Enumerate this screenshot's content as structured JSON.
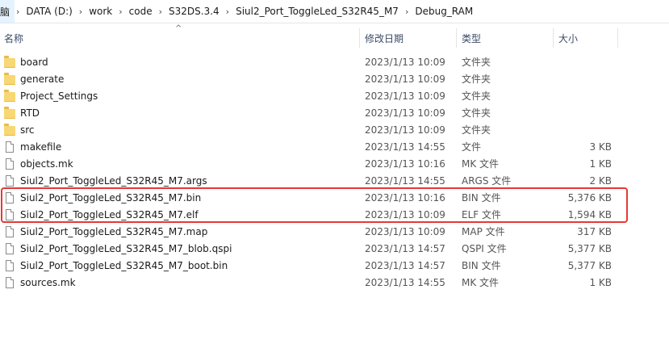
{
  "breadcrumb": {
    "items": [
      "脑",
      "DATA (D:)",
      "work",
      "code",
      "S32DS.3.4",
      "Siul2_Port_ToggleLed_S32R45_M7",
      "Debug_RAM"
    ],
    "separator": "›"
  },
  "columns": {
    "name": "名称",
    "date": "修改日期",
    "type": "类型",
    "size": "大小",
    "sort_indicator": "^"
  },
  "files": [
    {
      "name": "board",
      "date": "2023/1/13 10:09",
      "type": "文件夹",
      "size": "",
      "icon": "folder-icon"
    },
    {
      "name": "generate",
      "date": "2023/1/13 10:09",
      "type": "文件夹",
      "size": "",
      "icon": "folder-icon"
    },
    {
      "name": "Project_Settings",
      "date": "2023/1/13 10:09",
      "type": "文件夹",
      "size": "",
      "icon": "folder-icon"
    },
    {
      "name": "RTD",
      "date": "2023/1/13 10:09",
      "type": "文件夹",
      "size": "",
      "icon": "folder-icon"
    },
    {
      "name": "src",
      "date": "2023/1/13 10:09",
      "type": "文件夹",
      "size": "",
      "icon": "folder-icon"
    },
    {
      "name": "makefile",
      "date": "2023/1/13 14:55",
      "type": "文件",
      "size": "3 KB",
      "icon": "file-icon"
    },
    {
      "name": "objects.mk",
      "date": "2023/1/13 10:16",
      "type": "MK 文件",
      "size": "1 KB",
      "icon": "file-icon"
    },
    {
      "name": "Siul2_Port_ToggleLed_S32R45_M7.args",
      "date": "2023/1/13 14:55",
      "type": "ARGS 文件",
      "size": "2 KB",
      "icon": "file-icon"
    },
    {
      "name": "Siul2_Port_ToggleLed_S32R45_M7.bin",
      "date": "2023/1/13 10:16",
      "type": "BIN 文件",
      "size": "5,376 KB",
      "icon": "file-icon"
    },
    {
      "name": "Siul2_Port_ToggleLed_S32R45_M7.elf",
      "date": "2023/1/13 10:09",
      "type": "ELF 文件",
      "size": "1,594 KB",
      "icon": "file-icon"
    },
    {
      "name": "Siul2_Port_ToggleLed_S32R45_M7.map",
      "date": "2023/1/13 10:09",
      "type": "MAP 文件",
      "size": "317 KB",
      "icon": "file-icon"
    },
    {
      "name": "Siul2_Port_ToggleLed_S32R45_M7_blob.qspi",
      "date": "2023/1/13 14:57",
      "type": "QSPI 文件",
      "size": "5,377 KB",
      "icon": "file-icon"
    },
    {
      "name": "Siul2_Port_ToggleLed_S32R45_M7_boot.bin",
      "date": "2023/1/13 14:57",
      "type": "BIN 文件",
      "size": "5,377 KB",
      "icon": "file-icon"
    },
    {
      "name": "sources.mk",
      "date": "2023/1/13 14:55",
      "type": "MK 文件",
      "size": "1 KB",
      "icon": "file-icon"
    }
  ],
  "annotation": {
    "color": "#e53935",
    "highlighted_files": [
      "Siul2_Port_ToggleLed_S32R45_M7.bin",
      "Siul2_Port_ToggleLed_S32R45_M7.elf"
    ]
  }
}
